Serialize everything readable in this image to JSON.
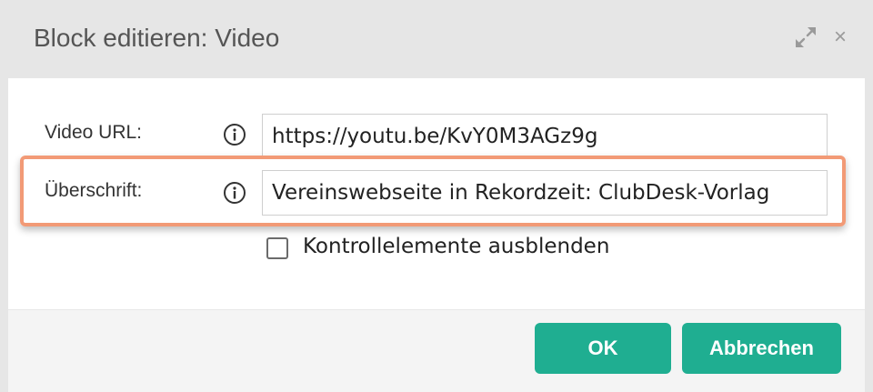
{
  "dialog": {
    "title": "Block editieren: Video",
    "maximize_icon": "expand-arrows-icon",
    "close_icon": "close-icon",
    "close_glyph": "×"
  },
  "form": {
    "video_url": {
      "label": "Video URL:",
      "value": "https://youtu.be/KvY0M3AGz9g",
      "info_icon": "info-circle-icon"
    },
    "heading": {
      "label": "Überschrift:",
      "value": "Vereinswebseite in Rekordzeit: ClubDesk-Vorlag",
      "info_icon": "info-circle-icon",
      "highlight_color": "#f29a76"
    },
    "hide_controls": {
      "label": "Kontrollelemente ausblenden",
      "checked": false
    }
  },
  "buttons": {
    "ok": "OK",
    "cancel": "Abbrechen",
    "color": "#1fae91"
  }
}
